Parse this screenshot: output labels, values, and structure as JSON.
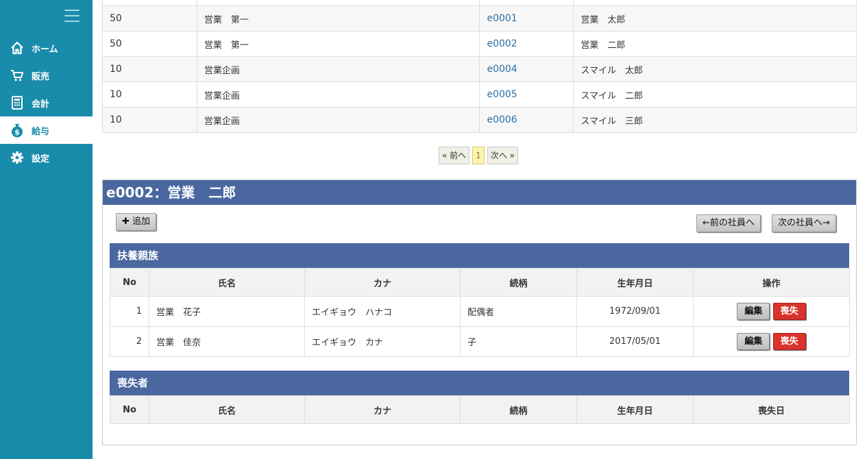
{
  "sidebar": {
    "items": [
      {
        "label": "ホーム",
        "icon": "home-icon"
      },
      {
        "label": "販売",
        "icon": "cart-icon"
      },
      {
        "label": "会計",
        "icon": "calculator-icon"
      },
      {
        "label": "給与",
        "icon": "money-bag-icon",
        "active": true
      },
      {
        "label": "設定",
        "icon": "gear-icon"
      }
    ]
  },
  "employees": [
    {
      "dept_code": "50",
      "dept": "営業　第一",
      "id": "e0001",
      "name": "営業　太郎"
    },
    {
      "dept_code": "50",
      "dept": "営業　第一",
      "id": "e0002",
      "name": "営業　二郎"
    },
    {
      "dept_code": "10",
      "dept": "営業企画",
      "id": "e0004",
      "name": "スマイル　太郎"
    },
    {
      "dept_code": "10",
      "dept": "営業企画",
      "id": "e0005",
      "name": "スマイル　二郎"
    },
    {
      "dept_code": "10",
      "dept": "営業企画",
      "id": "e0006",
      "name": "スマイル　三郎"
    }
  ],
  "pager": {
    "prev": "« 前へ",
    "current": "1",
    "next": "次へ »"
  },
  "detail": {
    "title": "e0002：営業　二郎",
    "add_label": "✚ 追加",
    "prev_emp": "←前の社員へ",
    "next_emp": "次の社員へ→"
  },
  "dependents": {
    "heading": "扶養親族",
    "columns": [
      "No",
      "氏名",
      "カナ",
      "続柄",
      "生年月日",
      "操作"
    ],
    "rows": [
      {
        "no": "1",
        "name": "営業　花子",
        "kana": "エイギョウ　ハナコ",
        "rel": "配偶者",
        "birth": "1972/09/01"
      },
      {
        "no": "2",
        "name": "営業　佳奈",
        "kana": "エイギョウ　カナ",
        "rel": "子",
        "birth": "2017/05/01"
      }
    ],
    "edit_label": "編集",
    "lost_label": "喪失"
  },
  "lost": {
    "heading": "喪失者",
    "columns": [
      "No",
      "氏名",
      "カナ",
      "続柄",
      "生年月日",
      "喪失日"
    ]
  },
  "colors": {
    "sidebar": "#1a8cab",
    "header": "#4a67a0",
    "danger": "#d9332b",
    "link": "#2a6fa8"
  }
}
